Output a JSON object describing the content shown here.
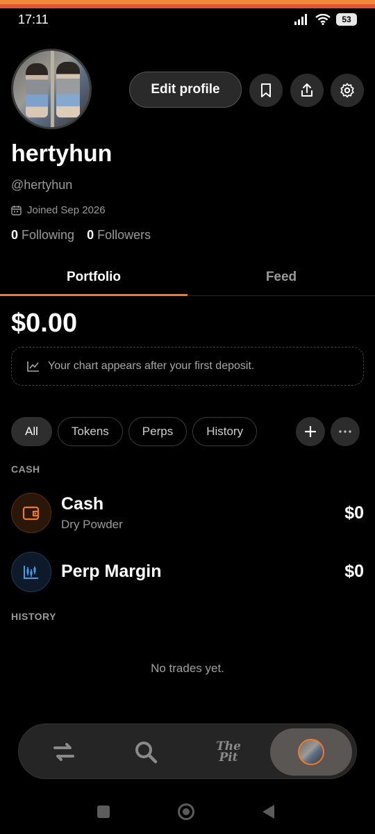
{
  "status_bar": {
    "time": "17:11",
    "battery": "53"
  },
  "profile": {
    "display_name": "hertyhun",
    "handle": "@hertyhun",
    "joined": "Joined Sep 2026",
    "following_count": "0",
    "following_label": "Following",
    "followers_count": "0",
    "followers_label": "Followers",
    "edit_label": "Edit profile"
  },
  "tabs": [
    {
      "label": "Portfolio",
      "active": true
    },
    {
      "label": "Feed",
      "active": false
    }
  ],
  "portfolio": {
    "balance": "$0.00",
    "chart_note": "Your chart appears after your first deposit."
  },
  "filters": [
    {
      "label": "All",
      "active": true
    },
    {
      "label": "Tokens",
      "active": false
    },
    {
      "label": "Perps",
      "active": false
    },
    {
      "label": "History",
      "active": false
    }
  ],
  "sections": {
    "cash_label": "CASH",
    "history_label": "HISTORY",
    "history_empty": "No trades yet."
  },
  "assets": [
    {
      "name": "Cash",
      "subtitle": "Dry Powder",
      "value": "$0",
      "icon": "wallet-icon"
    },
    {
      "name": "Perp Margin",
      "subtitle": "",
      "value": "$0",
      "icon": "candlestick-icon"
    }
  ],
  "bottom_nav": {
    "items": [
      "swap-icon",
      "search-icon",
      "the-pit-logo",
      "profile-avatar"
    ],
    "pit_line1": "The",
    "pit_line2": "Pit",
    "active": "profile-avatar"
  },
  "colors": {
    "accent": "#f07a2a",
    "background": "#000000",
    "muted": "#9a9a9a"
  }
}
